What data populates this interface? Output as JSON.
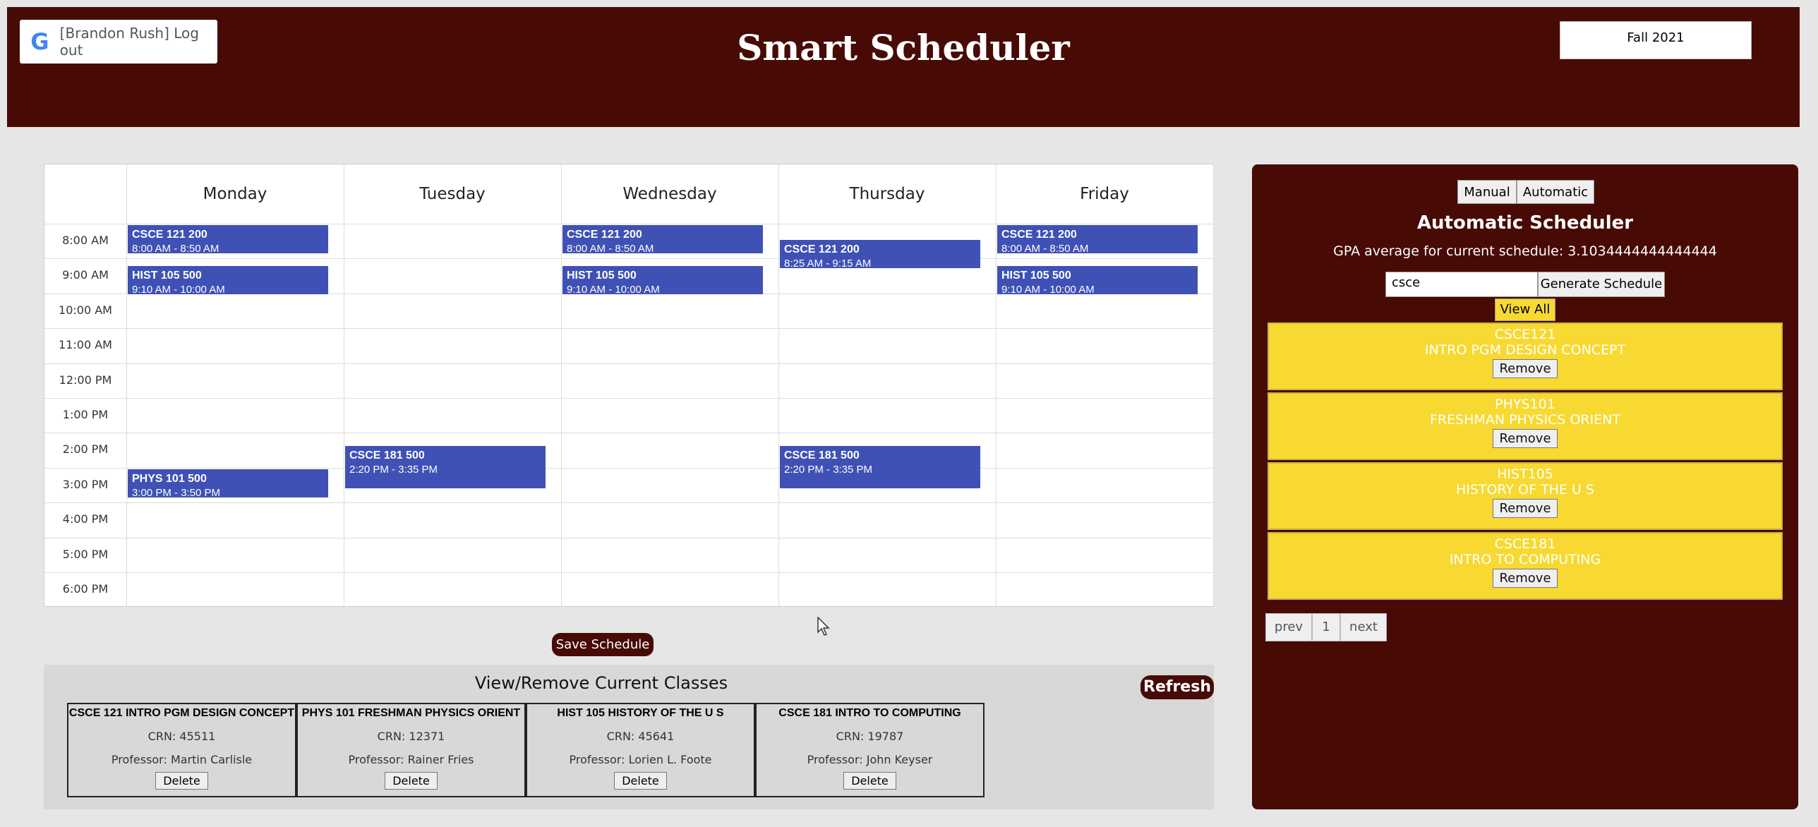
{
  "header": {
    "login_text": "[Brandon Rush] Log out",
    "google_icon": "google-logo-icon",
    "title": "Smart Scheduler",
    "term": "Fall 2021",
    "bg_color": "#470a04"
  },
  "calendar": {
    "days": [
      "Monday",
      "Tuesday",
      "Wednesday",
      "Thursday",
      "Friday"
    ],
    "times": [
      "8:00 AM",
      "9:00 AM",
      "10:00 AM",
      "11:00 AM",
      "12:00 PM",
      "1:00 PM",
      "2:00 PM",
      "3:00 PM",
      "4:00 PM",
      "5:00 PM",
      "6:00 PM"
    ],
    "event_color": "#4051b5",
    "events": [
      {
        "day": 0,
        "start": 8.0,
        "end": 8.83,
        "name": "CSCE 121 200",
        "time": "8:00 AM - 8:50 AM"
      },
      {
        "day": 2,
        "start": 8.0,
        "end": 8.83,
        "name": "CSCE 121 200",
        "time": "8:00 AM - 8:50 AM"
      },
      {
        "day": 4,
        "start": 8.0,
        "end": 8.83,
        "name": "CSCE 121 200",
        "time": "8:00 AM - 8:50 AM"
      },
      {
        "day": 3,
        "start": 8.42,
        "end": 9.25,
        "name": "CSCE 121 200",
        "time": "8:25 AM - 9:15 AM"
      },
      {
        "day": 0,
        "start": 9.17,
        "end": 10.0,
        "name": "HIST 105 500",
        "time": "9:10 AM - 10:00 AM"
      },
      {
        "day": 2,
        "start": 9.17,
        "end": 10.0,
        "name": "HIST 105 500",
        "time": "9:10 AM - 10:00 AM"
      },
      {
        "day": 4,
        "start": 9.17,
        "end": 10.0,
        "name": "HIST 105 500",
        "time": "9:10 AM - 10:00 AM"
      },
      {
        "day": 1,
        "start": 14.33,
        "end": 15.58,
        "name": "CSCE 181 500",
        "time": "2:20 PM - 3:35 PM"
      },
      {
        "day": 3,
        "start": 14.33,
        "end": 15.58,
        "name": "CSCE 181 500",
        "time": "2:20 PM - 3:35 PM"
      },
      {
        "day": 0,
        "start": 15.0,
        "end": 15.83,
        "name": "PHYS 101 500",
        "time": "3:00 PM - 3:50 PM"
      }
    ]
  },
  "save_label": "Save Schedule",
  "current": {
    "title": "View/Remove Current Classes",
    "refresh_label": "Refresh",
    "classes": [
      {
        "name": "CSCE 121 INTRO PGM DESIGN CONCEPT",
        "crn": "CRN: 45511",
        "prof": "Professor: Martin Carlisle",
        "delete": "Delete"
      },
      {
        "name": "PHYS 101 FRESHMAN PHYSICS ORIENT",
        "crn": "CRN: 12371",
        "prof": "Professor: Rainer Fries",
        "delete": "Delete"
      },
      {
        "name": "HIST 105 HISTORY OF THE U S",
        "crn": "CRN: 45641",
        "prof": "Professor: Lorien L. Foote",
        "delete": "Delete"
      },
      {
        "name": "CSCE 181 INTRO TO COMPUTING",
        "crn": "CRN: 19787",
        "prof": "Professor: John Keyser",
        "delete": "Delete"
      }
    ]
  },
  "panel": {
    "manual_label": "Manual",
    "auto_label": "Automatic",
    "title": "Automatic Scheduler",
    "gpa_text": "GPA average for current schedule: 3.1034444444444444",
    "search_value": "csce",
    "generate_label": "Generate Schedule",
    "view_all_label": "View All",
    "card_color": "#f7d931",
    "courses": [
      {
        "code": "CSCE121",
        "title": "INTRO PGM DESIGN CONCEPT",
        "remove": "Remove"
      },
      {
        "code": "PHYS101",
        "title": "FRESHMAN PHYSICS ORIENT",
        "remove": "Remove"
      },
      {
        "code": "HIST105",
        "title": "HISTORY OF THE U S",
        "remove": "Remove"
      },
      {
        "code": "CSCE181",
        "title": "INTRO TO COMPUTING",
        "remove": "Remove"
      }
    ],
    "pager": {
      "prev": "prev",
      "page": "1",
      "next": "next"
    }
  }
}
